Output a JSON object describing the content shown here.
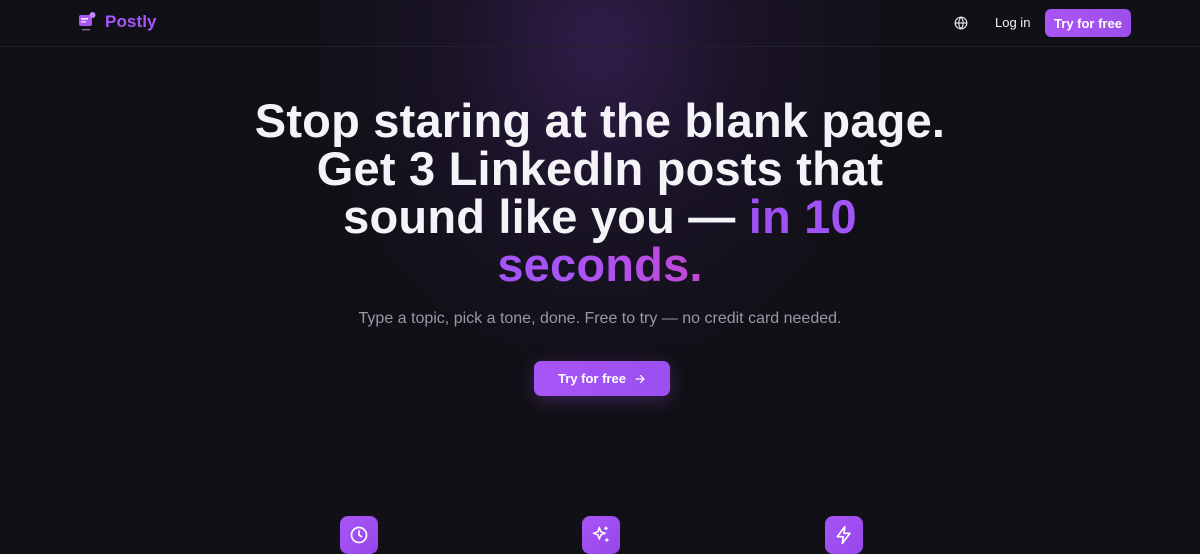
{
  "header": {
    "brand_name": "Postly",
    "logo_icon": "post-card-logo-icon",
    "language_icon": "globe-icon",
    "login_label": "Log in",
    "cta_label": "Try for free"
  },
  "hero": {
    "title_line_main": "Stop staring at the blank page. Get 3 LinkedIn posts that sound like you — ",
    "title_accent": "in 10 seconds.",
    "subtitle": "Type a topic, pick a tone, done. Free to try — no credit card needed.",
    "cta_label": "Try for free",
    "cta_icon": "arrow-right-icon"
  },
  "features": [
    {
      "icon": "clock-icon"
    },
    {
      "icon": "sparkles-icon"
    },
    {
      "icon": "lightning-icon"
    }
  ],
  "colors": {
    "background": "#111016",
    "accent": "#a855f7",
    "accent_pink": "#c248d6",
    "text": "#f4f3f7",
    "muted_text": "#9a98a6"
  }
}
